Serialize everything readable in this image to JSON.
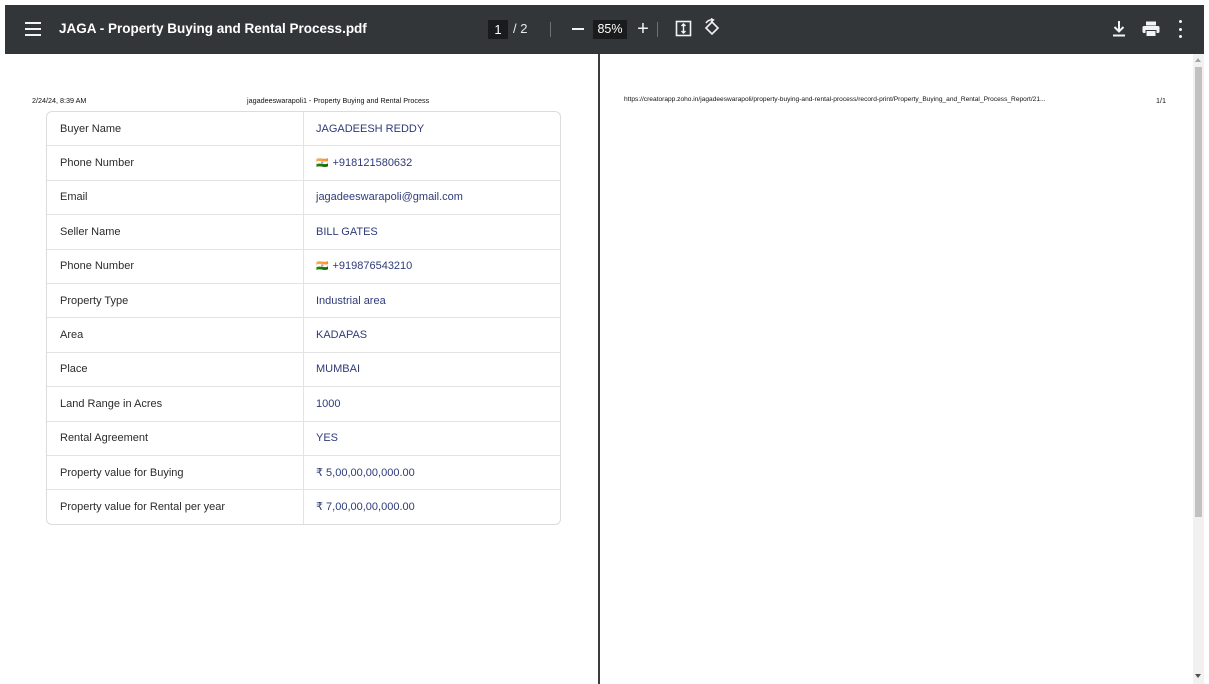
{
  "toolbar": {
    "title": "JAGA - Property Buying and Rental Process.pdf",
    "current_page": "1",
    "total_pages": "/ 2",
    "zoom": "85%"
  },
  "page1": {
    "header_left": "2/24/24, 8:39 AM",
    "header_center": "jagadeeswarapoli1 - Property Buying and Rental Process"
  },
  "page2": {
    "header_url": "https://creatorapp.zoho.in/jagadeeswarapoli/property-buying-and-rental-process/record-print/Property_Buying_and_Rental_Process_Report/21...",
    "header_page": "1/1"
  },
  "record": [
    {
      "label": "Buyer Name",
      "value": "JAGADEESH REDDY"
    },
    {
      "label": "Phone Number",
      "value": "+918121580632",
      "icon": "flag-icon"
    },
    {
      "label": "Email",
      "value": "jagadeeswarapoli@gmail.com"
    },
    {
      "label": "Seller Name",
      "value": "BILL GATES"
    },
    {
      "label": "Phone Number",
      "value": "+919876543210",
      "icon": "flag-icon"
    },
    {
      "label": "Property Type",
      "value": "Industrial area"
    },
    {
      "label": "Area",
      "value": "KADAPAS"
    },
    {
      "label": "Place",
      "value": "MUMBAI"
    },
    {
      "label": "Land Range in Acres",
      "value": "1000"
    },
    {
      "label": "Rental Agreement",
      "value": "YES"
    },
    {
      "label": "Property value for Buying",
      "value": "₹ 5,00,00,00,000.00"
    },
    {
      "label": "Property value for Rental per year",
      "value": "₹ 7,00,00,00,000.00"
    }
  ],
  "phone_flag_glyph": "🇮🇳"
}
